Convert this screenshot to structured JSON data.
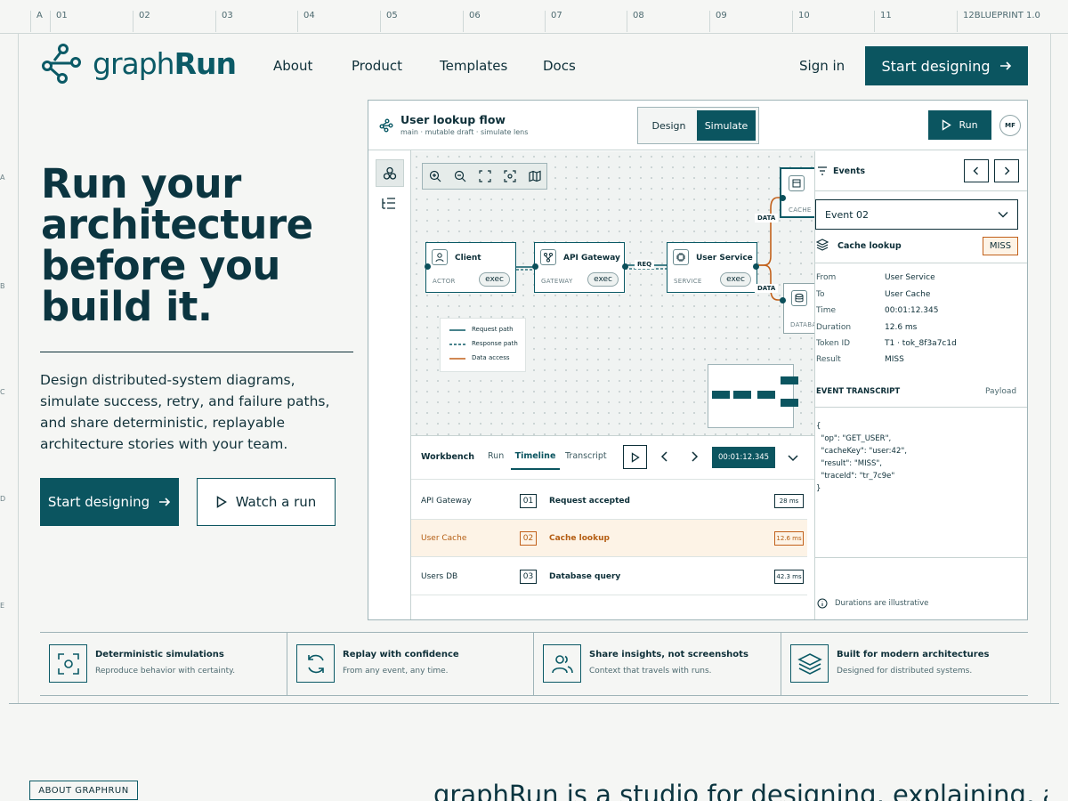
{
  "ruler": {
    "cols": [
      "A",
      "01",
      "02",
      "03",
      "04",
      "05",
      "06",
      "07",
      "08",
      "09",
      "10",
      "11",
      "12"
    ],
    "version": "BLUEPRINT 1.0",
    "rows": [
      "A",
      "B",
      "C",
      "D",
      "E"
    ]
  },
  "brand": {
    "name_light": "graph",
    "name_bold": "Run",
    "accent": "#0b5560"
  },
  "nav": {
    "items": [
      "About",
      "Product",
      "Templates",
      "Docs"
    ],
    "signin": "Sign in",
    "cta": "Start designing"
  },
  "hero": {
    "title_lines": [
      "Run your",
      "architecture",
      "before you",
      "build it."
    ],
    "description": "Design distributed-system diagrams, simulate success, retry, and failure paths, and share deterministic, replayable architecture stories with your team.",
    "cta_primary": "Start designing",
    "cta_secondary": "Watch a run"
  },
  "app": {
    "title": "User lookup flow",
    "subtitle": "main · mutable draft · simulate lens",
    "modes": [
      "Design",
      "Simulate"
    ],
    "active_mode": "Simulate",
    "run_label": "Run",
    "avatar": "MF",
    "nodes": [
      {
        "name": "Client",
        "kind": "ACTOR",
        "badge": "exec"
      },
      {
        "name": "API Gateway",
        "kind": "GATEWAY",
        "badge": "exec"
      },
      {
        "name": "User Service",
        "kind": "SERVICE",
        "badge": "exec"
      },
      {
        "name": "CACHE"
      },
      {
        "name": "DATABASE"
      }
    ],
    "edge_labels": {
      "req": "REQ",
      "data1": "DATA",
      "data2": "DATA"
    },
    "legend": [
      "Request path",
      "Response path",
      "Data access"
    ],
    "legend_colors": [
      "#0b5a66",
      "#0b5a66",
      "#c2601a"
    ],
    "workbench": {
      "title": "Workbench",
      "tabs": [
        "Run",
        "Timeline",
        "Transcript"
      ],
      "active_tab": "Timeline",
      "time": "00:01:12.345",
      "rows": [
        {
          "service": "API Gateway",
          "num": "01",
          "event": "Request accepted",
          "dur": "28 ms"
        },
        {
          "service": "User Cache",
          "num": "02",
          "event": "Cache lookup",
          "dur": "12.6 ms"
        },
        {
          "service": "Users DB",
          "num": "03",
          "event": "Database query",
          "dur": "42.3 ms"
        }
      ]
    },
    "events": {
      "title": "Events",
      "selected": "Event 02",
      "heading": "Cache lookup",
      "status": "MISS",
      "fields": [
        {
          "k": "From",
          "v": "User Service"
        },
        {
          "k": "To",
          "v": "User Cache"
        },
        {
          "k": "Time",
          "v": "00:01:12.345"
        },
        {
          "k": "Duration",
          "v": "12.6 ms"
        },
        {
          "k": "Token ID",
          "v": "T1 · tok_8f3a7c1d"
        },
        {
          "k": "Result",
          "v": "MISS"
        }
      ],
      "transcript_title": "EVENT TRANSCRIPT",
      "payload_label": "Payload",
      "transcript": [
        "{",
        "  \"op\": \"GET_USER\",",
        "  \"cacheKey\": \"user:42\",",
        "  \"result\": \"MISS\",",
        "  \"traceId\": \"tr_7c9e\"",
        "}"
      ],
      "footnote": "Durations are illustrative"
    }
  },
  "features": [
    {
      "title": "Deterministic simulations",
      "desc": "Reproduce behavior with certainty.",
      "icon": "focus-icon"
    },
    {
      "title": "Replay with confidence",
      "desc": "From any event, any time.",
      "icon": "replay-icon"
    },
    {
      "title": "Share insights, not screenshots",
      "desc": "Context that travels with runs.",
      "icon": "users-icon"
    },
    {
      "title": "Built for modern architectures",
      "desc": "Designed for distributed systems.",
      "icon": "layers-icon"
    }
  ],
  "about": {
    "label": "ABOUT GRAPHRUN",
    "headline": "graphRun is a studio for designing, explaining, and"
  }
}
